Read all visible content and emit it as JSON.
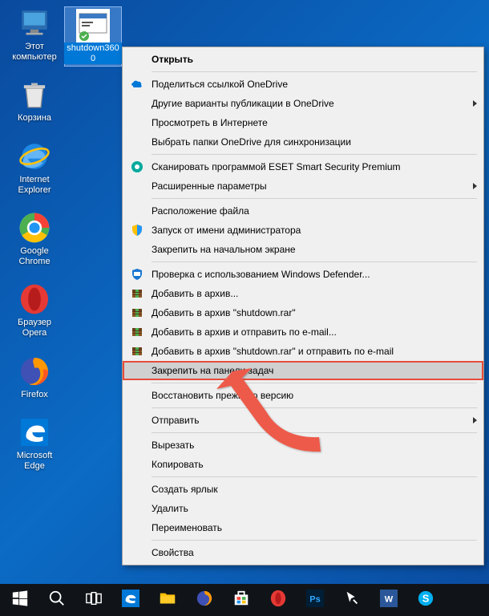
{
  "desktop_icons": [
    {
      "name": "this-pc",
      "label": "Этот\nкомпьютер"
    },
    {
      "name": "recycle-bin",
      "label": "Корзина"
    },
    {
      "name": "internet-explorer",
      "label": "Internet\nExplorer"
    },
    {
      "name": "google-chrome",
      "label": "Google\nChrome"
    },
    {
      "name": "opera",
      "label": "Браузер\nOpera"
    },
    {
      "name": "firefox",
      "label": "Firefox"
    },
    {
      "name": "microsoft-edge",
      "label": "Microsoft\nEdge"
    }
  ],
  "shortcut": {
    "label": "shutdown360\n0"
  },
  "context_menu": [
    {
      "t": "item",
      "label": "Открыть",
      "bold": true
    },
    {
      "t": "sep"
    },
    {
      "t": "item",
      "label": "Поделиться ссылкой OneDrive",
      "icon": "onedrive"
    },
    {
      "t": "item",
      "label": "Другие варианты публикации в OneDrive",
      "sub": true
    },
    {
      "t": "item",
      "label": "Просмотреть в Интернете"
    },
    {
      "t": "item",
      "label": "Выбрать папки OneDrive для синхронизации"
    },
    {
      "t": "sep"
    },
    {
      "t": "item",
      "label": "Сканировать программой ESET Smart Security Premium",
      "icon": "eset"
    },
    {
      "t": "item",
      "label": "Расширенные параметры",
      "sub": true
    },
    {
      "t": "sep"
    },
    {
      "t": "item",
      "label": "Расположение файла"
    },
    {
      "t": "item",
      "label": "Запуск от имени администратора",
      "icon": "shield"
    },
    {
      "t": "item",
      "label": "Закрепить на начальном экране"
    },
    {
      "t": "sep"
    },
    {
      "t": "item",
      "label": "Проверка с использованием Windows Defender...",
      "icon": "defender"
    },
    {
      "t": "item",
      "label": "Добавить в архив...",
      "icon": "winrar"
    },
    {
      "t": "item",
      "label": "Добавить в архив \"shutdown.rar\"",
      "icon": "winrar"
    },
    {
      "t": "item",
      "label": "Добавить в архив и отправить по e-mail...",
      "icon": "winrar"
    },
    {
      "t": "item",
      "label": "Добавить в архив \"shutdown.rar\" и отправить по e-mail",
      "icon": "winrar"
    },
    {
      "t": "item",
      "label": "Закрепить на панели задач",
      "hl": true
    },
    {
      "t": "sep"
    },
    {
      "t": "item",
      "label": "Восстановить прежнюю версию"
    },
    {
      "t": "sep"
    },
    {
      "t": "item",
      "label": "Отправить",
      "sub": true
    },
    {
      "t": "sep"
    },
    {
      "t": "item",
      "label": "Вырезать"
    },
    {
      "t": "item",
      "label": "Копировать"
    },
    {
      "t": "sep"
    },
    {
      "t": "item",
      "label": "Создать ярлык"
    },
    {
      "t": "item",
      "label": "Удалить"
    },
    {
      "t": "item",
      "label": "Переименовать"
    },
    {
      "t": "sep"
    },
    {
      "t": "item",
      "label": "Свойства"
    }
  ],
  "taskbar": [
    {
      "name": "start",
      "icon": "windows"
    },
    {
      "name": "search",
      "icon": "search"
    },
    {
      "name": "task-view",
      "icon": "taskview"
    },
    {
      "name": "edge",
      "icon": "edge"
    },
    {
      "name": "file-explorer",
      "icon": "folder"
    },
    {
      "name": "firefox",
      "icon": "firefox"
    },
    {
      "name": "store",
      "icon": "store"
    },
    {
      "name": "opera",
      "icon": "opera"
    },
    {
      "name": "photoshop",
      "icon": "ps"
    },
    {
      "name": "cursor-app",
      "icon": "cursor"
    },
    {
      "name": "word",
      "icon": "word"
    },
    {
      "name": "skype",
      "icon": "skype"
    }
  ]
}
